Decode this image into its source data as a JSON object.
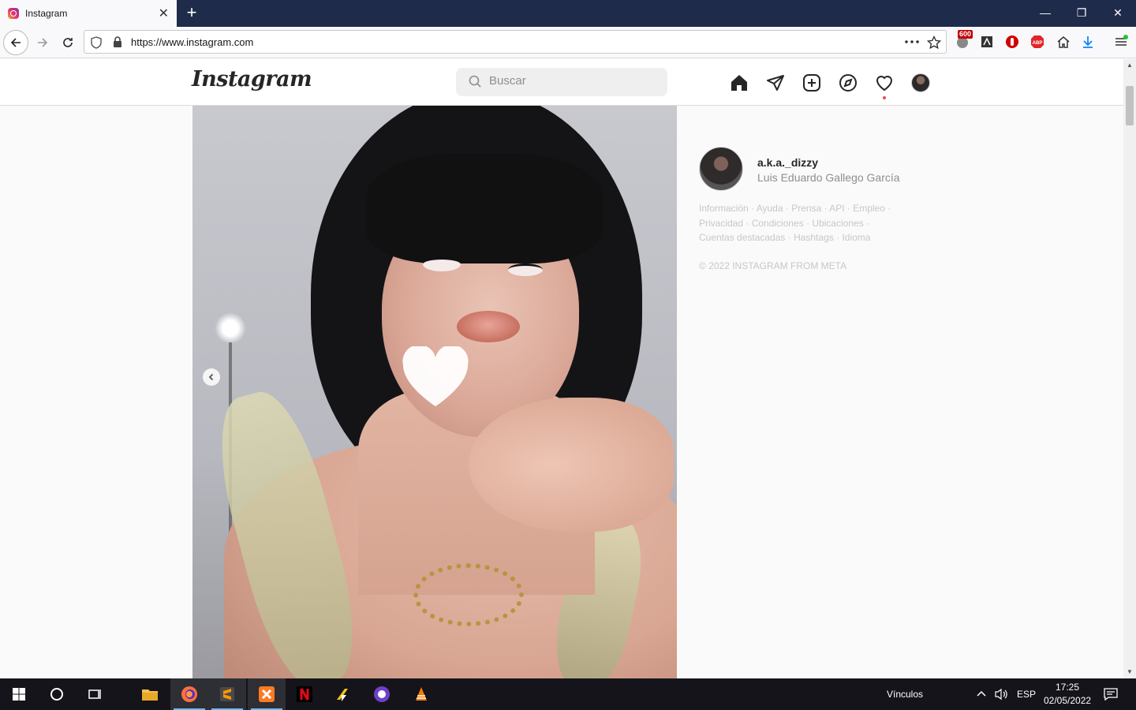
{
  "browser": {
    "tab_title": "Instagram",
    "tab_close": "✕",
    "new_tab": "+",
    "url": "https://www.instagram.com",
    "badge_count": "600",
    "window_controls": [
      "—",
      "❐",
      "✕"
    ]
  },
  "instagram": {
    "logo": "Instagram",
    "search_placeholder": "Buscar",
    "nav_icons": [
      "home-icon",
      "direct-icon",
      "new-post-icon",
      "explore-icon",
      "activity-heart-icon",
      "profile-avatar"
    ]
  },
  "sidebar": {
    "username": "a.k.a._dizzy",
    "full_name": "Luis Eduardo Gallego García",
    "footer_links": [
      "Información",
      "Ayuda",
      "Prensa",
      "API",
      "Empleo",
      "Privacidad",
      "Condiciones",
      "Ubicaciones",
      "Cuentas destacadas",
      "Hashtags",
      "Idioma"
    ],
    "copyright": "© 2022 INSTAGRAM FROM META"
  },
  "taskbar": {
    "links_label": "Vínculos",
    "language": "ESP",
    "time": "17:25",
    "date": "02/05/2022"
  },
  "colors": {
    "chrome_dark": "#1f2b4a",
    "taskbar": "#15141a",
    "notification_dot": "#ed4956"
  }
}
